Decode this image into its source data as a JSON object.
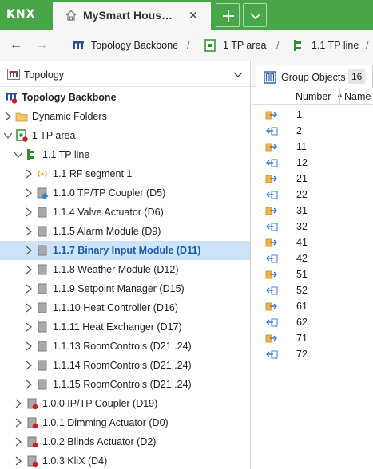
{
  "app": {
    "logo": "KNX",
    "tab_title": "MySmart Hous…"
  },
  "breadcrumb": [
    {
      "label": "Topology Backbone",
      "icon": "topology-icon"
    },
    {
      "label": "1 TP area",
      "icon": "area-icon"
    },
    {
      "label": "1.1 TP line",
      "icon": "line-icon"
    }
  ],
  "left_panel": {
    "title": "Topology",
    "tree": [
      {
        "label": "Topology Backbone",
        "icon": "topology-icon",
        "bold": true,
        "arrow": "none"
      },
      {
        "label": "Dynamic Folders",
        "icon": "folder-icon",
        "arrow": "right"
      },
      {
        "label": "1 TP area",
        "icon": "area-icon",
        "arrow": "down"
      },
      {
        "label": "1.1 TP line",
        "icon": "line-icon",
        "arrow": "down"
      },
      {
        "label": "1.1 RF segment 1",
        "icon": "rf-icon",
        "arrow": "right"
      },
      {
        "label": "1.1.0 TP/TP Coupler (D5)",
        "icon": "coupler-icon",
        "arrow": "right"
      },
      {
        "label": "1.1.4 Valve Actuator (D6)",
        "icon": "device-icon",
        "arrow": "right"
      },
      {
        "label": "1.1.5 Alarm Module (D9)",
        "icon": "device-icon",
        "arrow": "right"
      },
      {
        "label": "1.1.7 Binary Input Module (D11)",
        "icon": "device-icon",
        "arrow": "right",
        "selected": true
      },
      {
        "label": "1.1.8 Weather Module (D12)",
        "icon": "device-icon",
        "arrow": "right"
      },
      {
        "label": "1.1.9 Setpoint Manager (D15)",
        "icon": "device-icon",
        "arrow": "right"
      },
      {
        "label": "1.1.10 Heat Controller (D16)",
        "icon": "device-icon",
        "arrow": "right"
      },
      {
        "label": "1.1.11 Heat Exchanger (D17)",
        "icon": "device-icon",
        "arrow": "right"
      },
      {
        "label": "1.1.13 RoomControls (D21..24)",
        "icon": "device-icon",
        "arrow": "right"
      },
      {
        "label": "1.1.14 RoomControls (D21..24)",
        "icon": "device-icon",
        "arrow": "right"
      },
      {
        "label": "1.1.15 RoomControls (D21..24)",
        "icon": "device-icon",
        "arrow": "right"
      },
      {
        "label": "1.0.0 IP/TP Coupler (D19)",
        "icon": "device-error-icon",
        "arrow": "right"
      },
      {
        "label": "1.0.1 Dimming Actuator (D0)",
        "icon": "device-error-icon",
        "arrow": "right"
      },
      {
        "label": "1.0.2 Blinds Actuator (D2)",
        "icon": "device-error-icon",
        "arrow": "right"
      },
      {
        "label": "1.0.3 KliX (D4)",
        "icon": "device-error-icon",
        "arrow": "right"
      }
    ]
  },
  "right_panel": {
    "tab_label": "Group Objects",
    "tab_count": "16",
    "columns": {
      "number": "Number",
      "name": "Name"
    },
    "rows": [
      {
        "number": "1",
        "type": "send"
      },
      {
        "number": "2",
        "type": "receive"
      },
      {
        "number": "11",
        "type": "send"
      },
      {
        "number": "12",
        "type": "receive"
      },
      {
        "number": "21",
        "type": "send"
      },
      {
        "number": "22",
        "type": "receive"
      },
      {
        "number": "31",
        "type": "send"
      },
      {
        "number": "32",
        "type": "receive"
      },
      {
        "number": "41",
        "type": "send"
      },
      {
        "number": "42",
        "type": "receive"
      },
      {
        "number": "51",
        "type": "send"
      },
      {
        "number": "52",
        "type": "receive"
      },
      {
        "number": "61",
        "type": "send"
      },
      {
        "number": "62",
        "type": "receive"
      },
      {
        "number": "71",
        "type": "send"
      },
      {
        "number": "72",
        "type": "receive"
      }
    ]
  },
  "colors": {
    "brand_green": "#48a548",
    "selection": "#cde3f7",
    "error_red": "#d01f1f",
    "link_blue": "#1a5ea8"
  }
}
